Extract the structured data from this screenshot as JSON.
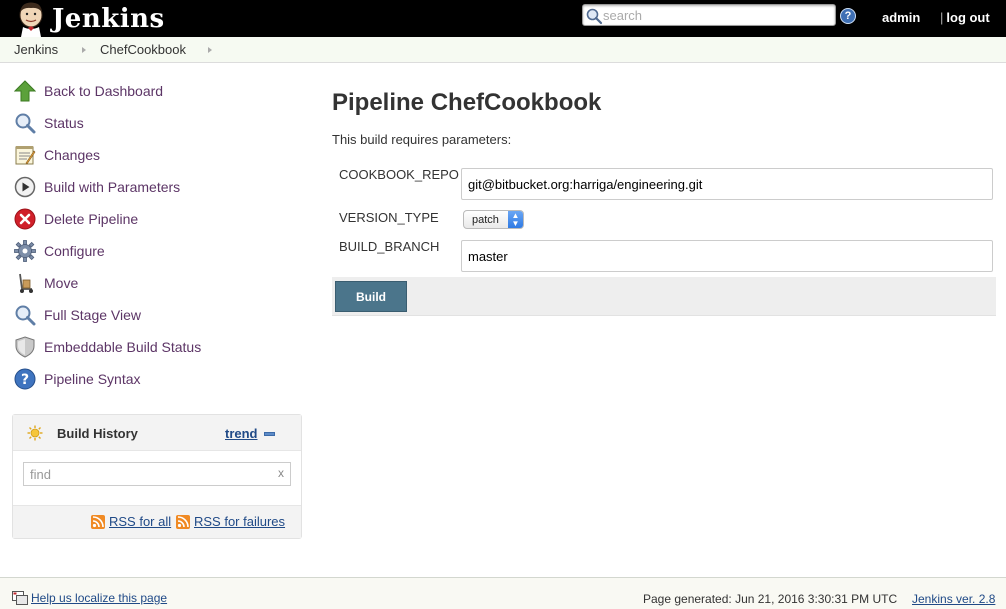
{
  "header": {
    "brand": "Jenkins",
    "search_placeholder": "search",
    "user": "admin",
    "logout": "log out"
  },
  "breadcrumb": [
    "Jenkins",
    "ChefCookbook"
  ],
  "sidebar": {
    "tasks": [
      {
        "label": "Back to Dashboard",
        "icon": "up-arrow-icon"
      },
      {
        "label": "Status",
        "icon": "magnifier-icon"
      },
      {
        "label": "Changes",
        "icon": "notepad-icon"
      },
      {
        "label": "Build with Parameters",
        "icon": "play-icon"
      },
      {
        "label": "Delete Pipeline",
        "icon": "delete-icon"
      },
      {
        "label": "Configure",
        "icon": "gear-icon"
      },
      {
        "label": "Move",
        "icon": "dolly-icon"
      },
      {
        "label": "Full Stage View",
        "icon": "magnifier-icon"
      },
      {
        "label": "Embeddable Build Status",
        "icon": "shield-icon"
      },
      {
        "label": "Pipeline Syntax",
        "icon": "help-icon"
      }
    ],
    "build_history": {
      "title": "Build History",
      "trend": "trend",
      "find_placeholder": "find",
      "clear": "x",
      "rss_all": "RSS for all",
      "rss_failures": "RSS for failures"
    }
  },
  "main": {
    "title": "Pipeline ChefCookbook",
    "description": "This build requires parameters:",
    "params": [
      {
        "name": "COOKBOOK_REPO",
        "value": "git@bitbucket.org:harriga/engineering.git"
      },
      {
        "name": "VERSION_TYPE",
        "value": "patch"
      },
      {
        "name": "BUILD_BRANCH",
        "value": "master"
      }
    ],
    "build_button": "Build"
  },
  "footer": {
    "localize": "Help us localize this page",
    "generated": "Page generated: Jun 21, 2016 3:30:31 PM UTC",
    "version": "Jenkins ver. 2.8"
  },
  "colors": {
    "header_bg": "#000000",
    "link": "#5c3566",
    "build_button": "#4b758b"
  }
}
